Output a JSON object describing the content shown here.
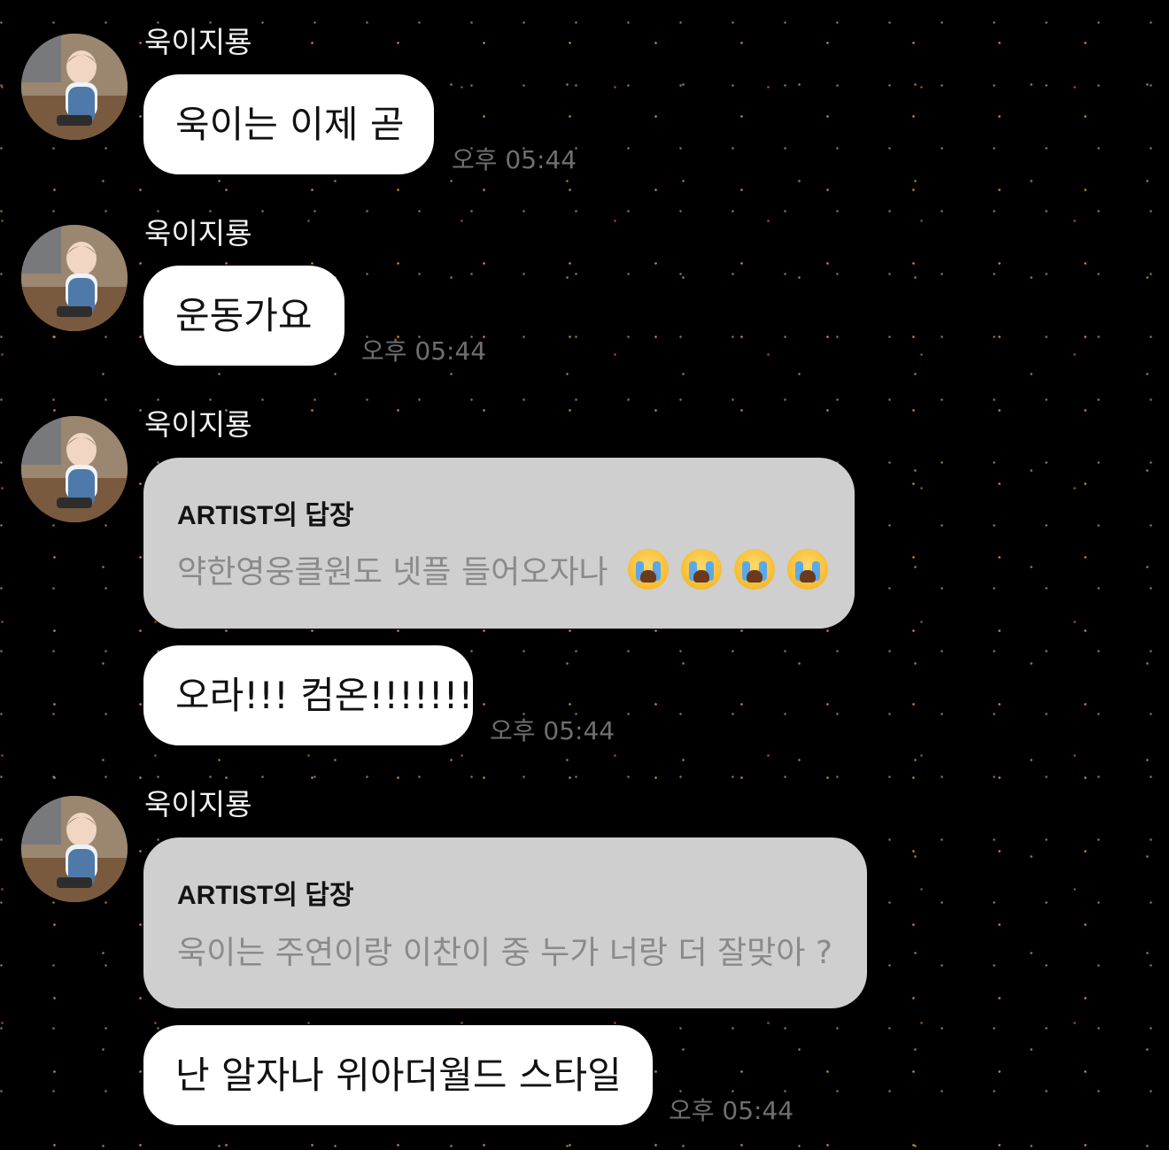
{
  "messages": [
    {
      "sender": "욱이지룡",
      "text": "욱이는 이제 곧",
      "time": "오후 05:44"
    },
    {
      "sender": "욱이지룡",
      "text": "운동가요",
      "time": "오후 05:44"
    },
    {
      "sender": "욱이지룡",
      "reply_title": "ARTIST의 답장",
      "reply_text": "약한영웅클원도 넷플 들어오자나",
      "reply_emoji": [
        "loudly-crying-face",
        "loudly-crying-face",
        "loudly-crying-face",
        "loudly-crying-face"
      ],
      "text": "오라!!! 컴온!!!!!!!",
      "time": "오후 05:44"
    },
    {
      "sender": "욱이지룡",
      "reply_title": "ARTIST의 답장",
      "reply_text": "욱이는 주연이랑 이찬이 중 누가 너랑 더 잘맞아 ?",
      "text": "난 알자나 위아더월드 스타일",
      "time": "오후 05:44"
    }
  ],
  "colors": {
    "background": "#000000",
    "bubble": "#ffffff",
    "reply_card": "#cfcfcf",
    "reply_text": "#8a8a8a",
    "timestamp": "#6f6f6f",
    "sender": "#f2f2f2"
  },
  "icons": {
    "avatar": "avatar-photo-toddler",
    "emoji": "loudly-crying-face-emoji"
  }
}
